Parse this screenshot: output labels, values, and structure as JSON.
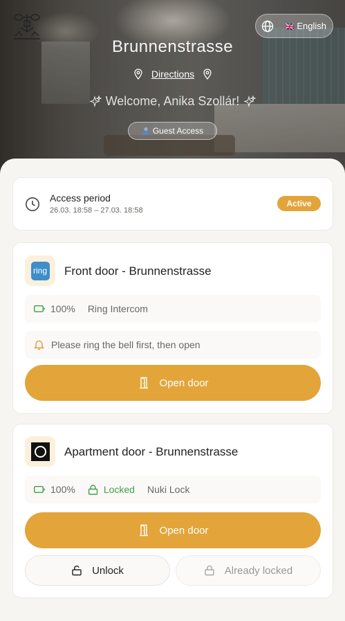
{
  "header": {
    "title": "Brunnenstrasse",
    "directions_label": "Directions",
    "welcome_text": "Welcome, Anika Szollár!",
    "guest_access_label": "Guest Access",
    "guest_access_icon": "person-icon",
    "language": {
      "flag": "🇬🇧",
      "label": "English",
      "icon": "globe-icon"
    }
  },
  "access": {
    "title": "Access period",
    "period": "26.03. 18:58 – 27.03. 18:58",
    "status": "Active",
    "status_color": "#e3a43a"
  },
  "doors": [
    {
      "name": "Front door - Brunnenstrasse",
      "logo_text": "ring",
      "battery": "100%",
      "device": "Ring Intercom",
      "notice": "Please ring the bell first, then open",
      "open_label": "Open door"
    },
    {
      "name": "Apartment door - Brunnenstrasse",
      "battery": "100%",
      "lock_state": "Locked",
      "device": "Nuki Lock",
      "open_label": "Open door",
      "unlock_label": "Unlock",
      "already_locked_label": "Already locked"
    }
  ],
  "colors": {
    "accent": "#e3a43a",
    "success": "#3ea048",
    "background": "#f7f5f2"
  }
}
